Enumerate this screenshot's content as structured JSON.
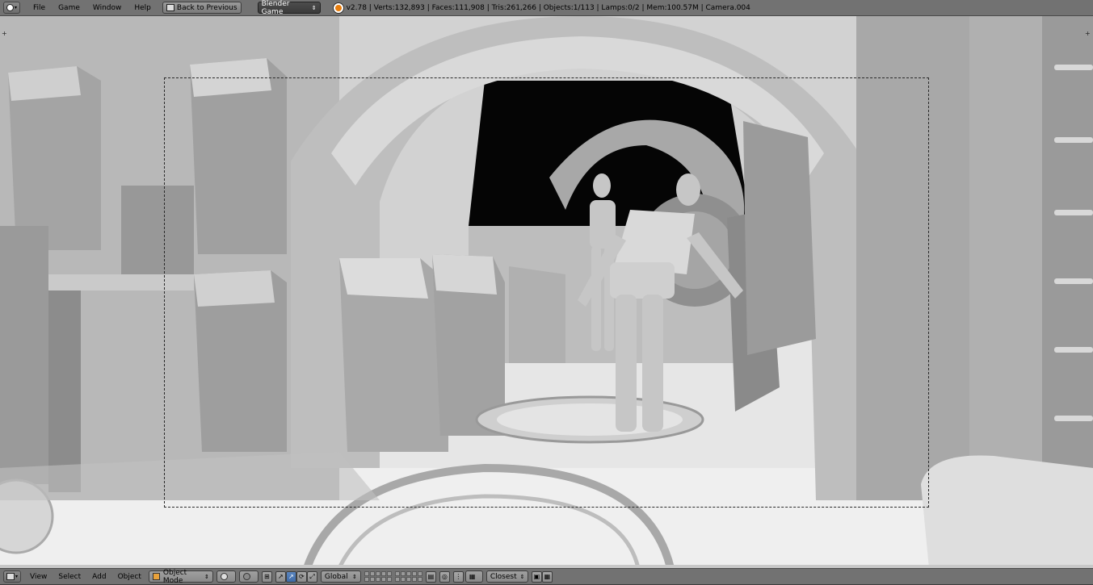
{
  "topbar": {
    "menus": [
      "File",
      "Game",
      "Window",
      "Help"
    ],
    "back_button": "Back to Previous",
    "engine": "Blender Game",
    "stats": "v2.78 | Verts:132,893 | Faces:111,908 | Tris:261,266 | Objects:1/113 | Lamps:0/2 | Mem:100.57M | Camera.004"
  },
  "bottombar": {
    "menus": [
      "View",
      "Select",
      "Add",
      "Object"
    ],
    "mode": "Object Mode",
    "orientation": "Global",
    "snap_target": "Closest"
  },
  "icons": {
    "editor_type": "info-editor-icon",
    "engine_logo": "blender-logo-icon",
    "viewport_editor": "3d-view-icon"
  },
  "colors": {
    "header_bg": "#727272",
    "active_button": "#4a78b4"
  }
}
